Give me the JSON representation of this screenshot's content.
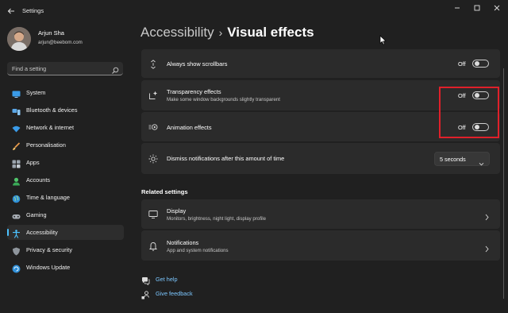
{
  "window": {
    "title": "Settings"
  },
  "user": {
    "name": "Arjun Sha",
    "email": "arjun@beebom.com"
  },
  "search": {
    "placeholder": "Find a setting"
  },
  "nav": {
    "items": [
      {
        "label": "System",
        "icon": "monitor-icon",
        "active": false
      },
      {
        "label": "Bluetooth & devices",
        "icon": "bluetooth-icon",
        "active": false
      },
      {
        "label": "Network & internet",
        "icon": "wifi-icon",
        "active": false
      },
      {
        "label": "Personalisation",
        "icon": "brush-icon",
        "active": false
      },
      {
        "label": "Apps",
        "icon": "apps-icon",
        "active": false
      },
      {
        "label": "Accounts",
        "icon": "person-icon",
        "active": false
      },
      {
        "label": "Time & language",
        "icon": "globe-clock-icon",
        "active": false
      },
      {
        "label": "Gaming",
        "icon": "gamepad-icon",
        "active": false
      },
      {
        "label": "Accessibility",
        "icon": "accessibility-icon",
        "active": true
      },
      {
        "label": "Privacy & security",
        "icon": "shield-icon",
        "active": false
      },
      {
        "label": "Windows Update",
        "icon": "update-icon",
        "active": false
      }
    ]
  },
  "breadcrumb": {
    "parent": "Accessibility",
    "separator": "›",
    "current": "Visual effects"
  },
  "settings": {
    "scrollbars": {
      "title": "Always show scrollbars",
      "state": "Off",
      "on": false
    },
    "transparency": {
      "title": "Transparency effects",
      "subtitle": "Make some window backgrounds slightly transparent",
      "state": "Off",
      "on": false
    },
    "animation": {
      "title": "Animation effects",
      "state": "Off",
      "on": false
    },
    "notifications_timeout": {
      "title": "Dismiss notifications after this amount of time",
      "value": "5 seconds"
    }
  },
  "related": {
    "title": "Related settings",
    "display": {
      "title": "Display",
      "subtitle": "Monitors, brightness, night light, display profile"
    },
    "notifications": {
      "title": "Notifications",
      "subtitle": "App and system notifications"
    }
  },
  "links": {
    "help": "Get help",
    "feedback": "Give feedback"
  },
  "colors": {
    "accent": "#4cc2ff",
    "highlight_box": "#e0202a",
    "background": "#202020",
    "card": "#2b2b2b"
  }
}
